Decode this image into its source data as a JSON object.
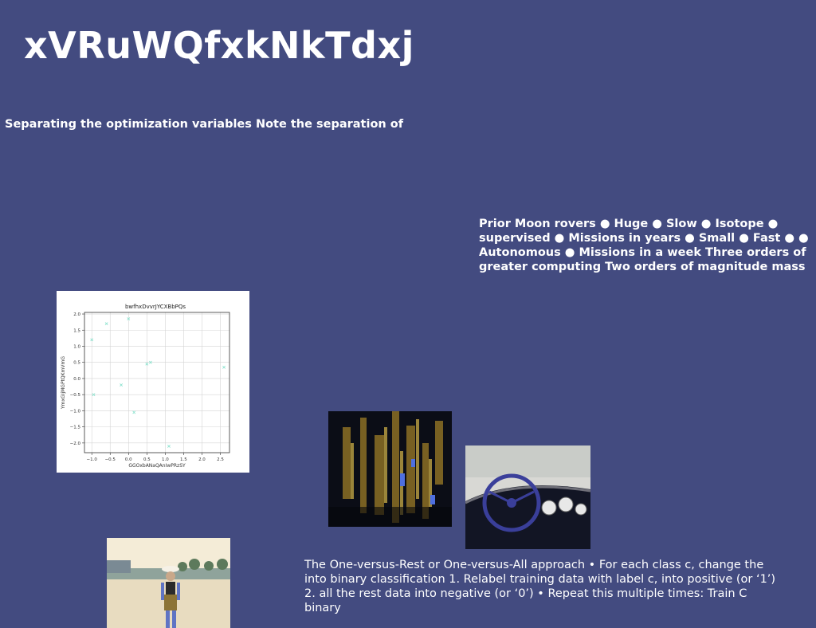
{
  "title": "xVRuWQfxkNkTdxj",
  "subtitle": "Separating the optimization variables Note the separation of",
  "rovers_text": "Prior Moon rovers ● Huge ● Slow ● Isotope ● supervised ● Missions in years ● Small ● Fast ● ● Autonomous ● Missions in a week Three orders of greater computing Two orders of magnitude mass",
  "ovr_text": "The One-versus-Rest or One-versus-All approach • For each class c, change the into binary classification 1. Relabel training data with label c, into positive (or ‘1’) 2. all the rest data into negative (or ‘0’) • Repeat this multiple times: Train C binary",
  "images": {
    "abstract": "abstract-geometric-image",
    "car": "vintage-car-dashboard-image",
    "beach": "beach-woman-image"
  },
  "chart_data": {
    "type": "scatter",
    "title": "bwfhxDvvrJYCXBbPQs",
    "xlabel": "GGOxbANaQAnIwPRzSY",
    "ylabel": "YmxGIjMGPtQKmVmG",
    "xlim": [
      -1.2,
      2.75
    ],
    "ylim": [
      -2.3,
      2.05
    ],
    "xticks": [
      -1.0,
      -0.5,
      0.0,
      0.5,
      1.0,
      1.5,
      2.0,
      2.5
    ],
    "yticks": [
      2.0,
      1.5,
      1.0,
      0.5,
      0.0,
      -0.5,
      -1.0,
      -1.5,
      -2.0
    ],
    "xtick_labels": [
      "−1.0",
      "−0.5",
      "0.0",
      "0.5",
      "1.0",
      "1.5",
      "2.0",
      "2.5"
    ],
    "ytick_labels": [
      "2.0",
      "1.5",
      "1.0",
      "0.5",
      "0.0",
      "−0.5",
      "−1.0",
      "−1.5",
      "−2.0"
    ],
    "grid": true,
    "marker_color": "#8fe3d0",
    "series": [
      {
        "x": [
          -1.0,
          -0.95,
          -0.6,
          0.0,
          -0.2,
          0.5,
          0.6,
          0.15,
          1.1,
          2.6
        ],
        "y": [
          1.2,
          -0.5,
          1.7,
          1.85,
          -0.2,
          0.45,
          0.5,
          -1.05,
          -2.1,
          0.35
        ]
      }
    ]
  }
}
